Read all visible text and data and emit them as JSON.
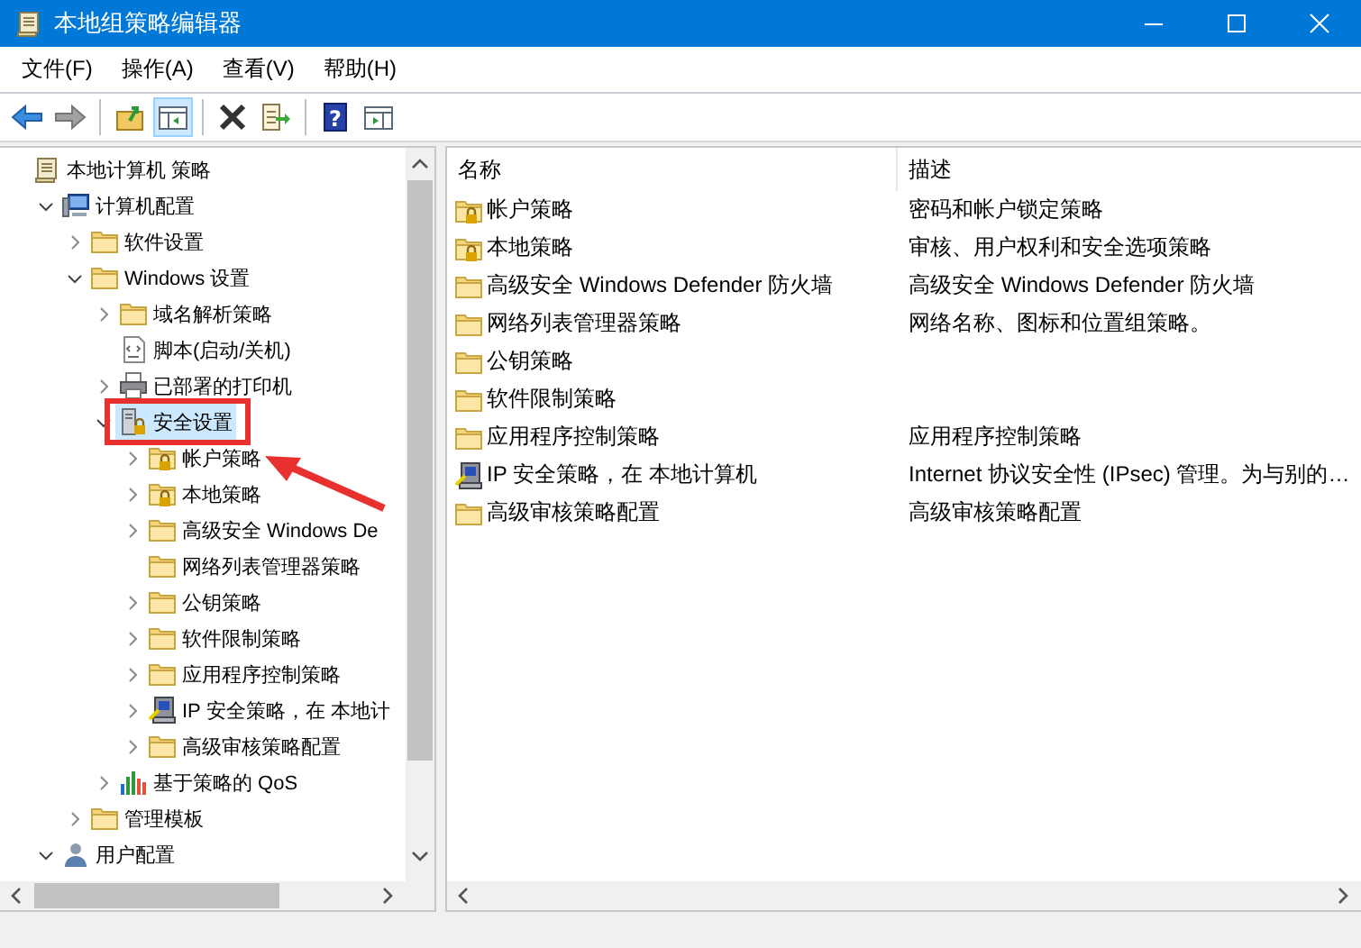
{
  "window": {
    "title": "本地组策略编辑器"
  },
  "menu": [
    "文件(F)",
    "操作(A)",
    "查看(V)",
    "帮助(H)"
  ],
  "toolbar": [
    {
      "kind": "back",
      "disabled": false,
      "pressed": false
    },
    {
      "kind": "forward",
      "disabled": true,
      "pressed": false
    },
    {
      "kind": "separator"
    },
    {
      "kind": "up",
      "disabled": false,
      "pressed": false
    },
    {
      "kind": "tree",
      "disabled": false,
      "pressed": true
    },
    {
      "kind": "separator"
    },
    {
      "kind": "delete",
      "disabled": false,
      "pressed": false
    },
    {
      "kind": "export",
      "disabled": false,
      "pressed": false
    },
    {
      "kind": "separator"
    },
    {
      "kind": "help",
      "glyph": "?",
      "disabled": false,
      "pressed": false
    },
    {
      "kind": "pane",
      "disabled": false,
      "pressed": false
    }
  ],
  "tree": [
    {
      "label": "本地计算机 策略",
      "kind": "scroll",
      "selected": false,
      "children": [
        {
          "label": "计算机配置",
          "kind": "computer",
          "expanded": true,
          "selected": false,
          "children": [
            {
              "label": "软件设置",
              "kind": "folder",
              "expanded": false,
              "selected": false
            },
            {
              "label": "Windows 设置",
              "kind": "folder",
              "expanded": true,
              "selected": false,
              "children": [
                {
                  "label": "域名解析策略",
                  "kind": "folder",
                  "expanded": false,
                  "selected": false
                },
                {
                  "label": "脚本(启动/关机)",
                  "kind": "script",
                  "selected": false
                },
                {
                  "label": "已部署的打印机",
                  "kind": "printer",
                  "expanded": false,
                  "selected": false
                },
                {
                  "label": "安全设置",
                  "kind": "security",
                  "expanded": true,
                  "selected": true,
                  "framed": true,
                  "children": [
                    {
                      "label": "帐户策略",
                      "kind": "folder-lock",
                      "expanded": false,
                      "selected": false,
                      "pointed": true
                    },
                    {
                      "label": "本地策略",
                      "kind": "folder-lock",
                      "expanded": false,
                      "selected": false
                    },
                    {
                      "label": "高级安全 Windows De",
                      "kind": "folder",
                      "expanded": false,
                      "selected": false
                    },
                    {
                      "label": "网络列表管理器策略",
                      "kind": "folder",
                      "selected": false
                    },
                    {
                      "label": "公钥策略",
                      "kind": "folder",
                      "expanded": false,
                      "selected": false
                    },
                    {
                      "label": "软件限制策略",
                      "kind": "folder",
                      "expanded": false,
                      "selected": false
                    },
                    {
                      "label": "应用程序控制策略",
                      "kind": "folder",
                      "expanded": false,
                      "selected": false
                    },
                    {
                      "label": "IP 安全策略，在 本地计",
                      "kind": "ip",
                      "expanded": false,
                      "selected": false
                    },
                    {
                      "label": "高级审核策略配置",
                      "kind": "folder",
                      "expanded": false,
                      "selected": false
                    }
                  ]
                },
                {
                  "label": "基于策略的 QoS",
                  "kind": "chart",
                  "expanded": false,
                  "selected": false
                }
              ]
            },
            {
              "label": "管理模板",
              "kind": "folder",
              "expanded": false,
              "selected": false
            }
          ]
        },
        {
          "label": "用户配置",
          "kind": "user",
          "expanded": true,
          "selected": false
        }
      ]
    }
  ],
  "list": {
    "columns": [
      "名称",
      "描述"
    ],
    "rows": [
      {
        "name": "帐户策略",
        "kind": "folder-lock",
        "description": "密码和帐户锁定策略"
      },
      {
        "name": "本地策略",
        "kind": "folder-lock",
        "description": "审核、用户权利和安全选项策略"
      },
      {
        "name": "高级安全 Windows Defender 防火墙",
        "kind": "folder",
        "description": "高级安全 Windows Defender 防火墙"
      },
      {
        "name": "网络列表管理器策略",
        "kind": "folder",
        "description": "网络名称、图标和位置组策略。"
      },
      {
        "name": "公钥策略",
        "kind": "folder"
      },
      {
        "name": "软件限制策略",
        "kind": "folder"
      },
      {
        "name": "应用程序控制策略",
        "kind": "folder",
        "description": "应用程序控制策略"
      },
      {
        "name": "IP 安全策略，在 本地计算机",
        "kind": "ip",
        "description": "Internet 协议安全性 (IPsec) 管理。为与别的…"
      },
      {
        "name": "高级审核策略配置",
        "kind": "folder",
        "description": "高级审核策略配置"
      }
    ]
  }
}
